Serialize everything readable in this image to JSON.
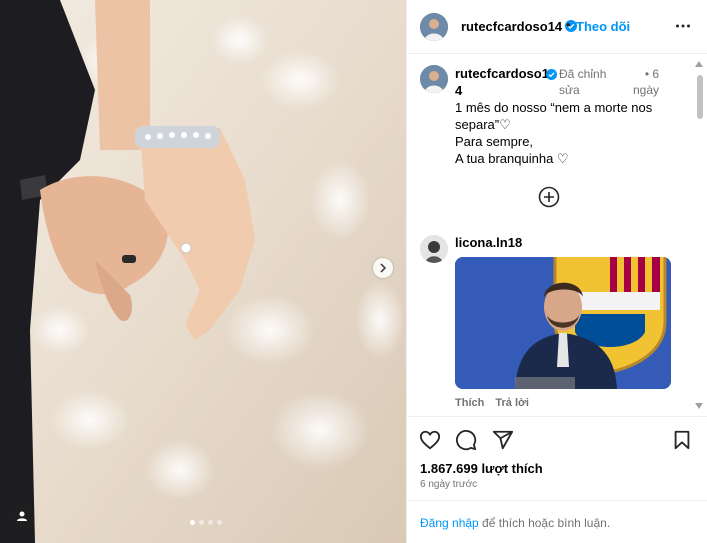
{
  "post": {
    "username": "rutecfcardoso14",
    "follow_label": "Theo dõi",
    "caption": {
      "username_line1": "rutecfcardoso1",
      "username_line2": "4",
      "edited_line1": "Đã chỉnh",
      "edited_line2": "sửa",
      "time_line1": "• 6",
      "time_line2": "ngày",
      "lines": [
        "1 mês do nosso “nem a morte nos",
        "separa”♡",
        "Para sempre,",
        "A tua branquinha ♡"
      ]
    },
    "comment": {
      "username": "licona.ln18",
      "gif_icon": "barcelona-press-gif",
      "like_label": "Thích",
      "reply_label": "Trả lời"
    },
    "likes": "1.867.699 lượt thích",
    "posted": "6 ngày trước",
    "login_link": "Đăng nhập",
    "login_text": " để thích hoặc bình luận."
  },
  "media": {
    "carousel_total": 4,
    "carousel_active": 1
  },
  "colors": {
    "accent": "#0095f6",
    "verified": "#0095f6",
    "muted": "#737373"
  }
}
